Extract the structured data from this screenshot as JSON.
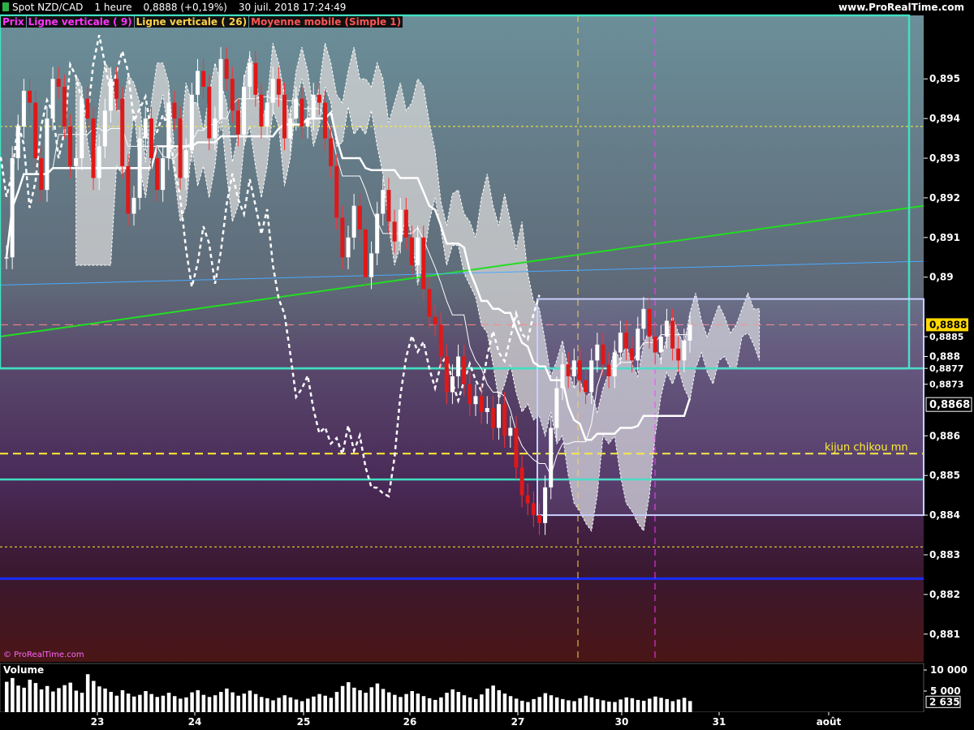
{
  "header": {
    "instrument": "Spot NZD/CAD",
    "timeframe": "1 heure",
    "price_change": "0,8888 (+0,19%)",
    "datetime": "30 juil. 2018 17:24:49",
    "brand": "www.ProRealTime.com"
  },
  "legend": [
    {
      "label": "Prix",
      "color": "#ff33ff"
    },
    {
      "label": "Ligne verticale ( 9)",
      "color": "#ff33ff"
    },
    {
      "label": "Ligne verticale ( 26)",
      "color": "#ffd24a"
    },
    {
      "label": "Moyenne mobile (Simple 1)",
      "color": "#ff5555"
    }
  ],
  "watermark": "© ProRealTime.com",
  "chart_data": {
    "type": "candlestick",
    "ylim": [
      0.8803,
      0.8966
    ],
    "y_ticks": [
      "0,895",
      "0,894",
      "0,893",
      "0,892",
      "0,891",
      "0,89",
      "0,888",
      "0,886",
      "0,885",
      "0,884",
      "0,883",
      "0,882",
      "0,881"
    ],
    "y_tick_values": [
      0.895,
      0.894,
      0.893,
      0.892,
      0.891,
      0.89,
      0.888,
      0.886,
      0.885,
      0.884,
      0.883,
      0.882,
      0.881
    ],
    "x_ticks": [
      "23",
      "24",
      "25",
      "26",
      "27",
      "30",
      "31",
      "août"
    ],
    "price_labels": [
      {
        "text": "0,8888",
        "value": 0.8888,
        "style": "current"
      },
      {
        "text": "0,8885",
        "value": 0.8885,
        "style": "plain"
      },
      {
        "text": "0,8877",
        "value": 0.8877,
        "style": "plain"
      },
      {
        "text": "0,8873",
        "value": 0.8873,
        "style": "plain"
      },
      {
        "text": "0,8868",
        "value": 0.8868,
        "style": "boxed"
      }
    ],
    "annotation": {
      "text": "kijun chikou mn",
      "value": 0.88555
    },
    "horizontal_lines": [
      {
        "value": 0.8877,
        "color": "#40e0c0",
        "style": "solid"
      },
      {
        "value": 0.8849,
        "color": "#40e0c0",
        "style": "solid"
      },
      {
        "value": 0.88555,
        "color": "#ffee33",
        "style": "dashed"
      },
      {
        "value": 0.8938,
        "color": "#ffee33",
        "style": "dotted"
      },
      {
        "value": 0.8832,
        "color": "#ffee33",
        "style": "dotted"
      },
      {
        "value": 0.8824,
        "color": "#1a2cff",
        "style": "solid"
      },
      {
        "value": 0.8888,
        "color": "#ff8888",
        "style": "dashed"
      }
    ],
    "trend_lines": [
      {
        "color": "#22dd22",
        "from": [
          0,
          0.8885
        ],
        "to": [
          1,
          0.8918
        ]
      },
      {
        "color": "#4aa8ff",
        "from": [
          0,
          0.8898
        ],
        "to": [
          1,
          0.8904
        ]
      }
    ],
    "boxes": [
      {
        "color": "#40e0c0",
        "top": 0.8966,
        "bottom": 0.8877
      },
      {
        "color": "#c8d0ff",
        "top": 0.88945,
        "bottom": 0.884
      }
    ],
    "series": [
      {
        "name": "Prix",
        "values": [
          0.8905,
          0.893,
          0.8938,
          0.8947,
          0.8944,
          0.893,
          0.8922,
          0.894,
          0.895,
          0.8948,
          0.8938,
          0.8928,
          0.893,
          0.8945,
          0.894,
          0.8925,
          0.8933,
          0.8942,
          0.895,
          0.8945,
          0.8928,
          0.8916,
          0.892,
          0.8935,
          0.894,
          0.893,
          0.8922,
          0.893,
          0.8944,
          0.894,
          0.8925,
          0.8932,
          0.8946,
          0.8952,
          0.8948,
          0.8935,
          0.894,
          0.8955,
          0.895,
          0.8942,
          0.8936,
          0.8948,
          0.8954,
          0.8946,
          0.8938,
          0.8944,
          0.895,
          0.8946,
          0.8935,
          0.894,
          0.8945,
          0.8938,
          0.894,
          0.8946,
          0.8944,
          0.8935,
          0.8928,
          0.8915,
          0.8905,
          0.891,
          0.8918,
          0.8912,
          0.89,
          0.8906,
          0.8916,
          0.8922,
          0.8914,
          0.8909,
          0.8917,
          0.891,
          0.8903,
          0.891,
          0.8897,
          0.889,
          0.8888,
          0.888,
          0.8871,
          0.8875,
          0.888,
          0.8873,
          0.8868,
          0.887,
          0.8866,
          0.8867,
          0.8862,
          0.8868,
          0.886,
          0.8862,
          0.8852,
          0.8845,
          0.8843,
          0.884,
          0.8838,
          0.8847,
          0.8862,
          0.8872,
          0.8878,
          0.8875,
          0.8879,
          0.8874,
          0.8871,
          0.8879,
          0.8883,
          0.8878,
          0.8875,
          0.8881,
          0.8886,
          0.8882,
          0.8879,
          0.8887,
          0.8892,
          0.8885,
          0.8881,
          0.8885,
          0.8889,
          0.8882,
          0.8879,
          0.8884,
          0.8888
        ]
      }
    ],
    "volume": {
      "label": "Volume",
      "y_ticks": [
        "10 000",
        "5 000"
      ],
      "last_label": "2 635",
      "max": 10000,
      "values": [
        7200,
        8100,
        6300,
        5800,
        7700,
        6900,
        5400,
        6200,
        4900,
        5700,
        6400,
        7000,
        5100,
        4600,
        9000,
        7400,
        6100,
        5600,
        4800,
        3900,
        5200,
        4400,
        3700,
        4100,
        5000,
        4300,
        3600,
        3900,
        4600,
        3800,
        3200,
        3500,
        4700,
        5200,
        4100,
        3600,
        4000,
        4800,
        5600,
        4700,
        3900,
        4400,
        5100,
        4300,
        3600,
        3300,
        2800,
        3400,
        4000,
        3500,
        3000,
        2600,
        3200,
        3700,
        4300,
        3900,
        3400,
        4800,
        6200,
        7100,
        5800,
        5200,
        4600,
        5900,
        6800,
        5500,
        4700,
        4100,
        3600,
        4300,
        5000,
        4400,
        3800,
        3300,
        2900,
        3500,
        4600,
        5400,
        4800,
        4000,
        3500,
        3100,
        4200,
        5600,
        6300,
        5200,
        4400,
        3800,
        3200,
        2700,
        2400,
        3100,
        3600,
        4500,
        4000,
        3500,
        3100,
        2800,
        2600,
        3300,
        3900,
        3500,
        3100,
        2800,
        2500,
        2400,
        3000,
        3500,
        3300,
        2900,
        2700,
        3200,
        3700,
        3400,
        3100,
        2600,
        3000,
        3400,
        2635
      ]
    }
  }
}
